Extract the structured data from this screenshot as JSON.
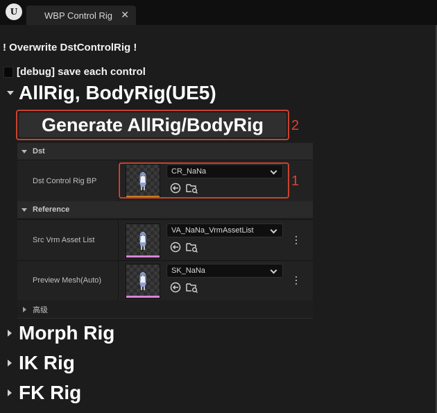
{
  "tab": {
    "title": "WBP Control Rig",
    "close_glyph": "✕"
  },
  "header": {
    "overwrite_label": "! Overwrite DstControlRig !",
    "debug_label": "[debug] save each control"
  },
  "sections": {
    "allrig": {
      "title": "AllRig, BodyRig(UE5)",
      "generate_label": "Generate AllRig/BodyRig"
    },
    "morph": {
      "title": "Morph Rig"
    },
    "ik": {
      "title": "IK Rig"
    },
    "fk": {
      "title": "FK Rig"
    }
  },
  "annotations": {
    "one": "1",
    "two": "2"
  },
  "dst": {
    "category": "Dst",
    "row": {
      "label": "Dst Control Rig BP",
      "value": "CR_NaNa",
      "bar_color": "#c77a1e"
    }
  },
  "reference": {
    "category": "Reference",
    "rows": [
      {
        "label": "Src Vrm Asset List",
        "value": "VA_NaNa_VrmAssetList",
        "bar_color": "#d685d6"
      },
      {
        "label": "Preview Mesh(Auto)",
        "value": "SK_NaNa",
        "bar_color": "#d685d6"
      }
    ]
  },
  "advanced": {
    "label": "高级"
  },
  "colors": {
    "annotation": "#e0412e",
    "background": "#1c1c1c"
  },
  "icons": {
    "use_selected": "arrow-back-circle-icon",
    "browse": "folder-search-icon",
    "more": "kebab-menu-icon",
    "engine": "unreal-logo-icon"
  }
}
